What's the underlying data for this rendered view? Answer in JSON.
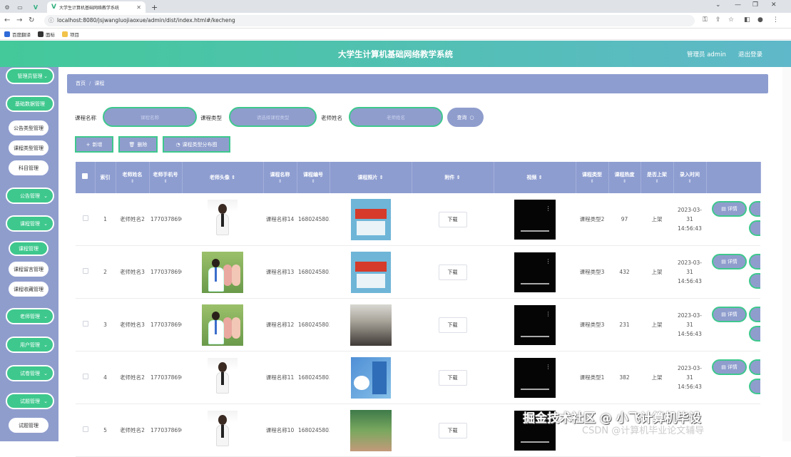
{
  "browser": {
    "active_tab_title": "大学生计算机基础网络教学系统",
    "url": "localhost:8080/jsjwangluojiaoxue/admin/dist/index.html#/kecheng",
    "bookmarks": [
      "百度翻译",
      "面标",
      "项目"
    ]
  },
  "header": {
    "title": "大学生计算机基础网络教学系统",
    "admin_label": "管理员 admin",
    "logout_label": "退出登录"
  },
  "sidebar": {
    "items": [
      {
        "label": "管理员管理",
        "kind": "group"
      },
      {
        "label": "基础数据管理",
        "kind": "group-open"
      },
      {
        "label": "公告类型管理",
        "kind": "sub"
      },
      {
        "label": "课程类型管理",
        "kind": "sub"
      },
      {
        "label": "科目管理",
        "kind": "sub"
      },
      {
        "label": "公告管理",
        "kind": "group"
      },
      {
        "label": "课程管理",
        "kind": "group"
      },
      {
        "label": "课程管理",
        "kind": "sub-selected"
      },
      {
        "label": "课程留言管理",
        "kind": "sub"
      },
      {
        "label": "课程收藏管理",
        "kind": "sub"
      },
      {
        "label": "老师管理",
        "kind": "group"
      },
      {
        "label": "用户管理",
        "kind": "group"
      },
      {
        "label": "试卷管理",
        "kind": "group"
      },
      {
        "label": "试题管理",
        "kind": "group"
      },
      {
        "label": "试题管理",
        "kind": "sub"
      }
    ]
  },
  "breadcrumb": {
    "home": "首页",
    "sep": "/",
    "current": "课程"
  },
  "search": {
    "course_name_label": "课程名称",
    "course_name_placeholder": "课程名称",
    "course_type_label": "课程类型",
    "course_type_placeholder": "请选择课程类型",
    "teacher_name_label": "老师姓名",
    "teacher_name_placeholder": "老师姓名",
    "query_button": "查询"
  },
  "actions": {
    "add": "新增",
    "delete": "删除",
    "chart": "课程类型分布图"
  },
  "table": {
    "headers": [
      "索引",
      "老师姓名",
      "老师手机号",
      "老师头像",
      "课程名称",
      "课程编号",
      "课程照片",
      "附件",
      "视频",
      "课程类型",
      "课程热度",
      "是否上架",
      "录入时间"
    ],
    "download_label": "下载",
    "detail_label": "详情",
    "rows": [
      {
        "index": "1",
        "teacher": "老师姓名2",
        "phone": "17703786902",
        "avatar": "single",
        "course": "课程名称14",
        "code": "1680245803703",
        "photo": "book-red",
        "type": "课程类型2",
        "heat": "97",
        "onsale": "上架",
        "time": "2023-03-31 14:56:43"
      },
      {
        "index": "2",
        "teacher": "老师姓名3",
        "phone": "17703786903",
        "avatar": "group",
        "course": "课程名称13",
        "code": "1680245803645",
        "photo": "book-red",
        "type": "课程类型3",
        "heat": "432",
        "onsale": "上架",
        "time": "2023-03-31 14:56:43"
      },
      {
        "index": "3",
        "teacher": "老师姓名3",
        "phone": "17703786903",
        "avatar": "group",
        "course": "课程名称12",
        "code": "1680245803682",
        "photo": "classroom",
        "type": "课程类型3",
        "heat": "231",
        "onsale": "上架",
        "time": "2023-03-31 14:56:43"
      },
      {
        "index": "4",
        "teacher": "老师姓名2",
        "phone": "17703786902",
        "avatar": "single",
        "course": "课程名称11",
        "code": "1680245803660",
        "photo": "book-blue",
        "type": "课程类型1",
        "heat": "382",
        "onsale": "上架",
        "time": "2023-03-31 14:56:43"
      },
      {
        "index": "5",
        "teacher": "老师姓名2",
        "phone": "17703786902",
        "avatar": "single",
        "course": "课程名称10",
        "code": "1680245803705",
        "photo": "people",
        "type": "",
        "heat": "",
        "onsale": "",
        "time": ""
      }
    ]
  },
  "watermark": {
    "line1": "掘金技术社区 @ 小飞计算机毕设",
    "line2": "CSDN @计算机毕业论文辅导"
  },
  "colors": {
    "primary": "#8f9dcd",
    "accent_green": "#3ec88d",
    "header_gradient_start": "#43c99a",
    "header_gradient_end": "#5fb8c9"
  }
}
